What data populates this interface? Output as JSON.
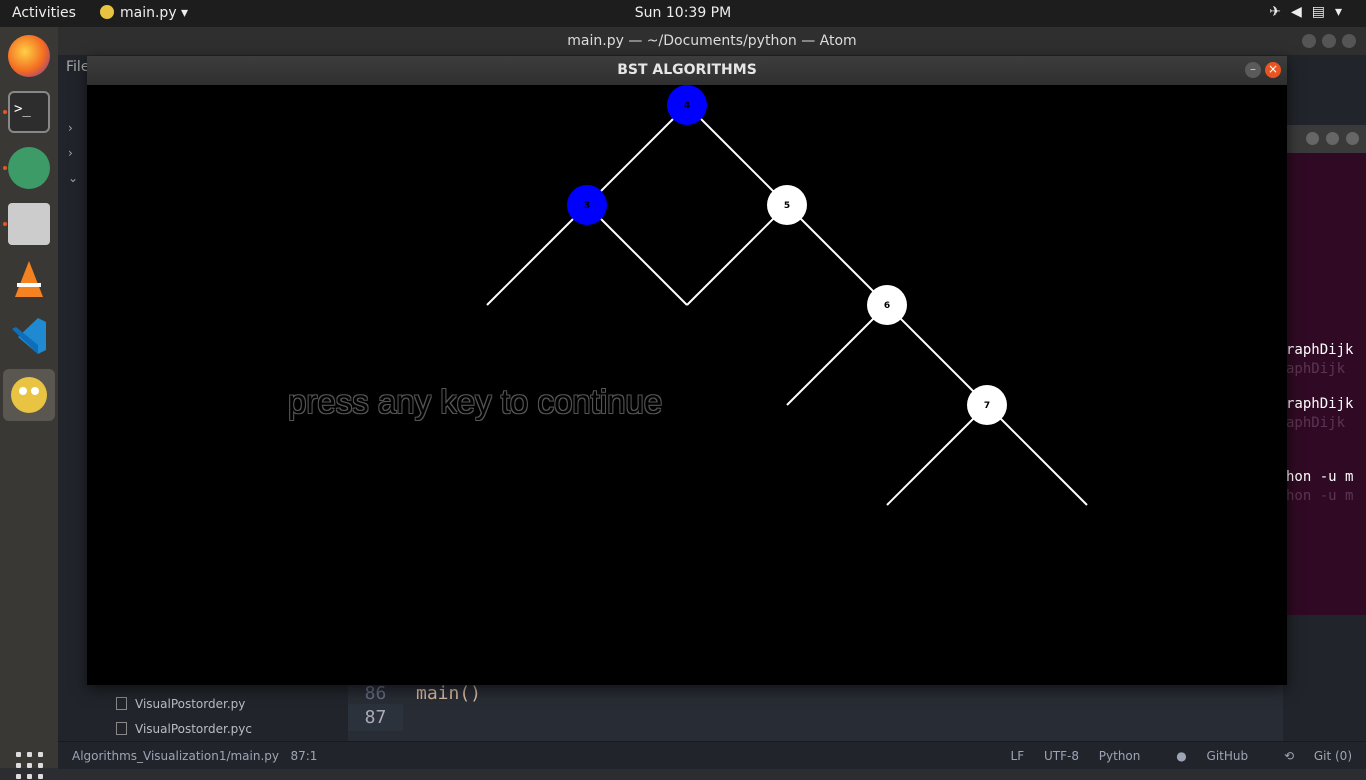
{
  "topbar": {
    "activities": "Activities",
    "app_name": "main.py",
    "clock": "Sun 10:39 PM",
    "tray_icons": [
      "airplane-icon",
      "volume-icon",
      "clipboard-icon",
      "power-icon"
    ]
  },
  "dock": {
    "items": [
      "firefox",
      "terminal",
      "atom",
      "files",
      "vlc",
      "vscode",
      "pygame"
    ],
    "apps_grid_icon": "show-applications-icon"
  },
  "atom": {
    "title": "main.py — ~/Documents/python — Atom",
    "menu_file": "File",
    "tree_files": [
      "VisualPostorder.py",
      "VisualPostorder.pyc"
    ],
    "editor_lines": [
      {
        "number": "86",
        "code": "main()"
      },
      {
        "number": "87",
        "code": ""
      }
    ],
    "status": {
      "path": "Algorithms_Visualization1/main.py",
      "cursor": "87:1",
      "line_ending": "LF",
      "encoding": "UTF-8",
      "grammar": "Python",
      "github": "GitHub",
      "git": "Git (0)"
    }
  },
  "terminal": {
    "lines": [
      "raphDijk",
      "aphDijk",
      "raphDijk",
      "aphDijk",
      "hon -u m",
      "hon -u m"
    ]
  },
  "bst_window": {
    "title": "BST ALGORITHMS",
    "prompt": "press any key to continue",
    "highlight_color": "#0000ff",
    "node_color": "#ffffff",
    "nodes": [
      {
        "label": "4",
        "highlighted": true
      },
      {
        "label": "3",
        "highlighted": true
      },
      {
        "label": "5",
        "highlighted": false
      },
      {
        "label": "6",
        "highlighted": false
      },
      {
        "label": "7",
        "highlighted": false
      }
    ]
  }
}
